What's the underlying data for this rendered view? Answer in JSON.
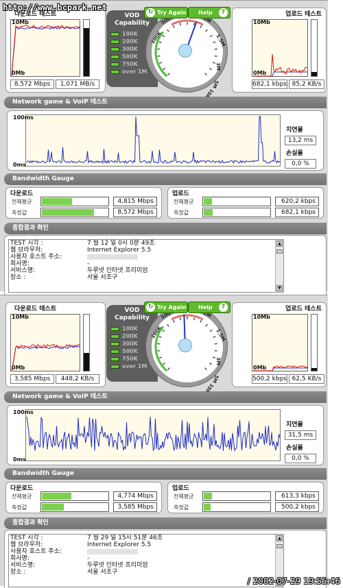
{
  "watermark": "http://www.bcpark.net",
  "timestamp": "/ 2002-07-29 19:55:46",
  "labels": {
    "download_test": "다운로드 테스트",
    "upload_test": "업로드 테스트",
    "vod_title_1": "VOD",
    "vod_title_2": "Capability",
    "try_again": "Try Again",
    "help": "Help",
    "network_section": "Network game & VoIP 테스트",
    "bandwidth_section": "Bandwidth Gauge",
    "result_section": "종합결과 확인",
    "latency": "지연율",
    "loss": "손실율",
    "download": "다운로드",
    "upload": "업로드",
    "avg": "전체평균",
    "measured": "측정값",
    "graph_max": "10Mb",
    "graph_min": "0Mb",
    "net_max": "100ms",
    "net_min": "0ms"
  },
  "vod_levels": [
    "100K",
    "200K",
    "300K",
    "500K",
    "750K",
    "over 1M"
  ],
  "gauge_ticks": [
    "100K",
    "500K",
    "1M",
    "1.5M",
    "3M",
    "5M",
    "10M"
  ],
  "panels": [
    {
      "download_mbps": "8,572 Mbps",
      "download_kbs": "1,071 MB/s",
      "upload_kbps": "682,1 kbps",
      "upload_kbs": "85,2 KB/s",
      "latency": "13,2 ms",
      "loss": "0,0 %",
      "dl_avg": "4,815 Mbps",
      "dl_meas": "8,572 Mbps",
      "ul_avg": "620,2 kbps",
      "ul_meas": "682,1 kbps",
      "dl_avg_frac": 0.45,
      "dl_meas_frac": 0.78,
      "ul_avg_frac": 0.12,
      "ul_meas_frac": 0.13,
      "dl_level": 0.85,
      "ul_level": 0.07,
      "needle_deg": 200,
      "results": [
        [
          "TEST 시각 :",
          "7 월 12 일  0시 0분 49초"
        ],
        [
          "웹 브라우저:",
          "Internet Explorer 5.5"
        ],
        [
          "사용자 호스트 주소:",
          ""
        ],
        [
          "회사명:",
          "-"
        ],
        [
          "서비스명:",
          "두루넷 인터넷 프리미엄"
        ],
        [
          "장소 :",
          "서울 서초구"
        ]
      ]
    },
    {
      "download_mbps": "3,585 Mbps",
      "download_kbs": "448,2 KB/s",
      "upload_kbps": "500,2 kbps",
      "upload_kbs": "62,5 KB/s",
      "latency": "31,5 ms",
      "loss": "0,0 %",
      "dl_avg": "4,774 Mbps",
      "dl_meas": "3,585 Mbps",
      "ul_avg": "613,3 kbps",
      "ul_meas": "500,2 kbps",
      "dl_avg_frac": 0.44,
      "dl_meas_frac": 0.33,
      "ul_avg_frac": 0.12,
      "ul_meas_frac": 0.1,
      "dl_level": 0.32,
      "ul_level": 0.05,
      "needle_deg": 178,
      "results": [
        [
          "TEST 시각 :",
          "7 월 29 일  15시 51분 46초"
        ],
        [
          "웹 브라우저:",
          "Internet Explorer 5.5"
        ],
        [
          "사용자 호스트 주소:",
          ""
        ],
        [
          "회사명:",
          "-"
        ],
        [
          "서비스명:",
          "두루넷 인터넷 프리미엄"
        ],
        [
          "장소 :",
          "서울 서초구"
        ]
      ]
    }
  ]
}
